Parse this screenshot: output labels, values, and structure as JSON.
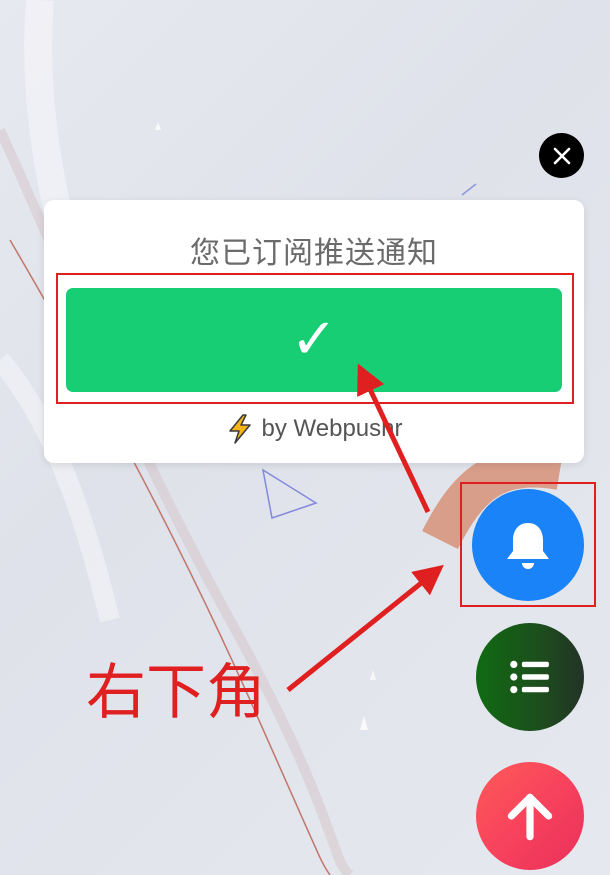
{
  "popup": {
    "title": "您已订阅推送通知",
    "subscribe_button_symbol": "✓",
    "powered_by_text": "by Webpushr"
  },
  "annotation": {
    "label": "右下角",
    "color": "#e02020"
  },
  "buttons": {
    "close_icon": "close-icon",
    "bell_icon": "bell-icon",
    "menu_icon": "list-icon",
    "top_icon": "arrow-up-icon"
  },
  "colors": {
    "subscribe_green": "#17ce74",
    "bell_blue": "#1a83f8",
    "menu_green": "#106b12",
    "top_red": "#f53e5c"
  }
}
